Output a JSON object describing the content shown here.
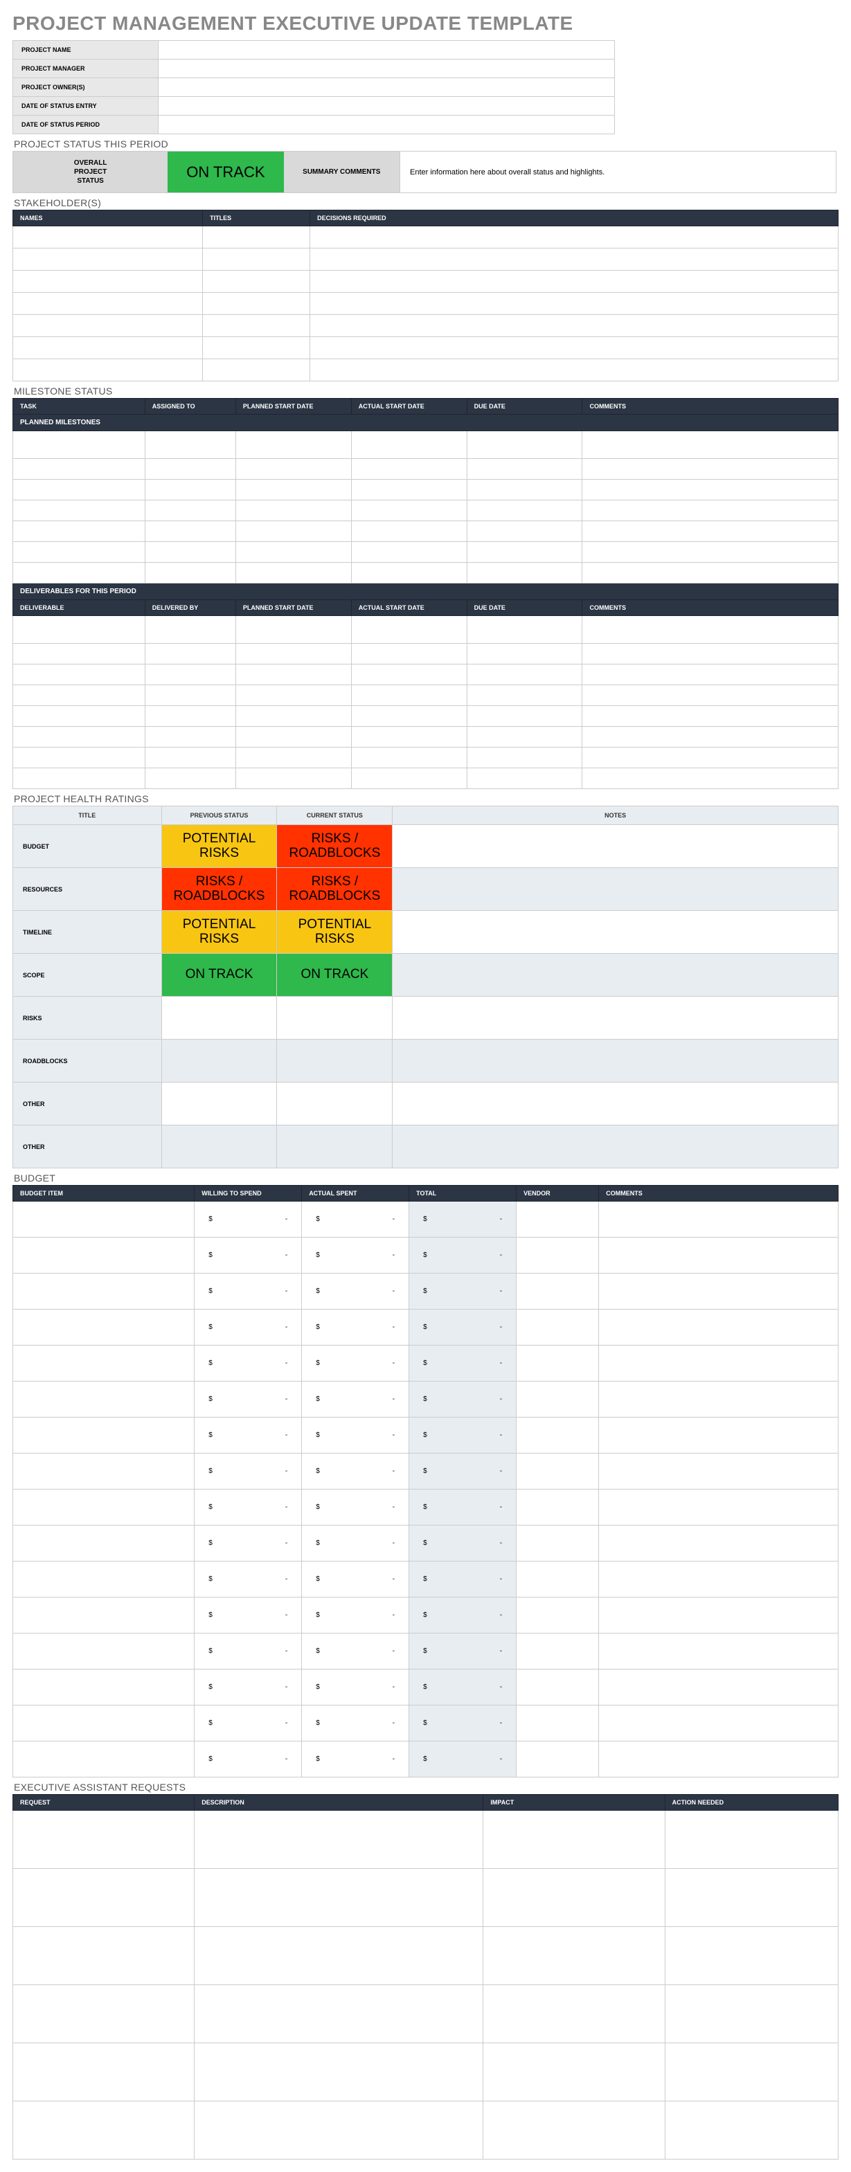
{
  "title": "PROJECT MANAGEMENT EXECUTIVE UPDATE TEMPLATE",
  "info": {
    "rows": [
      {
        "label": "PROJECT NAME",
        "value": ""
      },
      {
        "label": "PROJECT MANAGER",
        "value": ""
      },
      {
        "label": "PROJECT OWNER(S)",
        "value": ""
      },
      {
        "label": "DATE OF STATUS ENTRY",
        "value": ""
      },
      {
        "label": "DATE OF STATUS PERIOD",
        "value": ""
      }
    ]
  },
  "status": {
    "section": "PROJECT STATUS THIS PERIOD",
    "overall_label": "OVERALL\nPROJECT\nSTATUS",
    "value": "ON TRACK",
    "comments_label": "SUMMARY COMMENTS",
    "comments_text": "Enter information here about overall status and highlights."
  },
  "stakeholders": {
    "section": "STAKEHOLDER(S)",
    "headers": [
      "NAMES",
      "TITLES",
      "DECISIONS REQUIRED"
    ],
    "row_count": 7
  },
  "milestones": {
    "section": "MILESTONE STATUS",
    "planned_strip": "PLANNED MILESTONES",
    "planned_headers": [
      "TASK",
      "ASSIGNED TO",
      "PLANNED START DATE",
      "ACTUAL START DATE",
      "DUE DATE",
      "COMMENTS"
    ],
    "planned_rows": 7,
    "deliver_strip": "DELIVERABLES FOR THIS PERIOD",
    "deliver_headers": [
      "DELIVERABLE",
      "DELIVERED BY",
      "PLANNED START DATE",
      "ACTUAL START DATE",
      "DUE DATE",
      "COMMENTS"
    ],
    "deliver_rows": 8
  },
  "health": {
    "section": "PROJECT HEALTH RATINGS",
    "headers": [
      "TITLE",
      "PREVIOUS STATUS",
      "CURRENT STATUS",
      "NOTES"
    ],
    "rows": [
      {
        "title": "BUDGET",
        "prev": "POTENTIAL RISKS",
        "prev_c": "yellow",
        "curr": "RISKS / ROADBLOCKS",
        "curr_c": "red",
        "alt": false
      },
      {
        "title": "RESOURCES",
        "prev": "RISKS / ROADBLOCKS",
        "prev_c": "red",
        "curr": "RISKS / ROADBLOCKS",
        "curr_c": "red",
        "alt": true
      },
      {
        "title": "TIMELINE",
        "prev": "POTENTIAL RISKS",
        "prev_c": "yellow",
        "curr": "POTENTIAL RISKS",
        "curr_c": "yellow",
        "alt": false
      },
      {
        "title": "SCOPE",
        "prev": "ON TRACK",
        "prev_c": "green",
        "curr": "ON TRACK",
        "curr_c": "green",
        "alt": true
      },
      {
        "title": "RISKS",
        "prev": "",
        "prev_c": "",
        "curr": "",
        "curr_c": "",
        "alt": false
      },
      {
        "title": "ROADBLOCKS",
        "prev": "",
        "prev_c": "",
        "curr": "",
        "curr_c": "",
        "alt": true
      },
      {
        "title": "OTHER",
        "prev": "",
        "prev_c": "",
        "curr": "",
        "curr_c": "",
        "alt": false
      },
      {
        "title": "OTHER",
        "prev": "",
        "prev_c": "",
        "curr": "",
        "curr_c": "",
        "alt": true
      }
    ]
  },
  "budget": {
    "section": "BUDGET",
    "headers": [
      "BUDGET ITEM",
      "WILLING TO SPEND",
      "ACTUAL SPENT",
      "TOTAL",
      "VENDOR",
      "COMMENTS"
    ],
    "currency": "$",
    "dash": "-",
    "row_count": 16
  },
  "exec": {
    "section": "EXECUTIVE ASSISTANT REQUESTS",
    "headers": [
      "REQUEST",
      "DESCRIPTION",
      "IMPACT",
      "ACTION NEEDED"
    ],
    "row_count": 6
  }
}
